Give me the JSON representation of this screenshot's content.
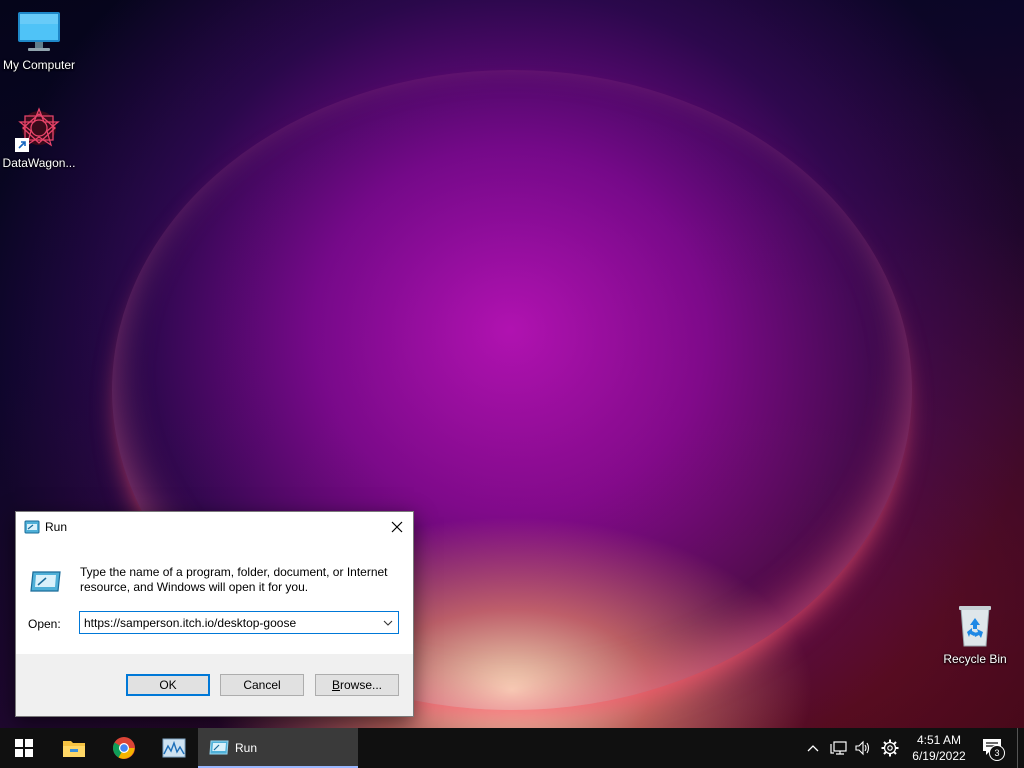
{
  "desktop": {
    "icons": [
      {
        "label": "My Computer"
      },
      {
        "label": "DataWagon..."
      },
      {
        "label": "Recycle Bin"
      }
    ]
  },
  "run_dialog": {
    "title": "Run",
    "description": "Type the name of a program, folder, document, or Internet resource, and Windows will open it for you.",
    "open_label": "Open:",
    "open_value": "https://samperson.itch.io/desktop-goose",
    "ok_label": "OK",
    "cancel_label": "Cancel",
    "browse_label": "Browse..."
  },
  "taskbar": {
    "start_icon": "windows-logo-icon",
    "pinned": [
      "file-explorer-icon",
      "chrome-icon",
      "performance-monitor-icon"
    ],
    "active_window_label": "Run",
    "clock": {
      "time": "4:51 AM",
      "date": "6/19/2022"
    },
    "notification_count": "3"
  },
  "colors": {
    "accent": "#0078d7",
    "taskbar": "#101010",
    "active_task": "#3a3a3a"
  }
}
